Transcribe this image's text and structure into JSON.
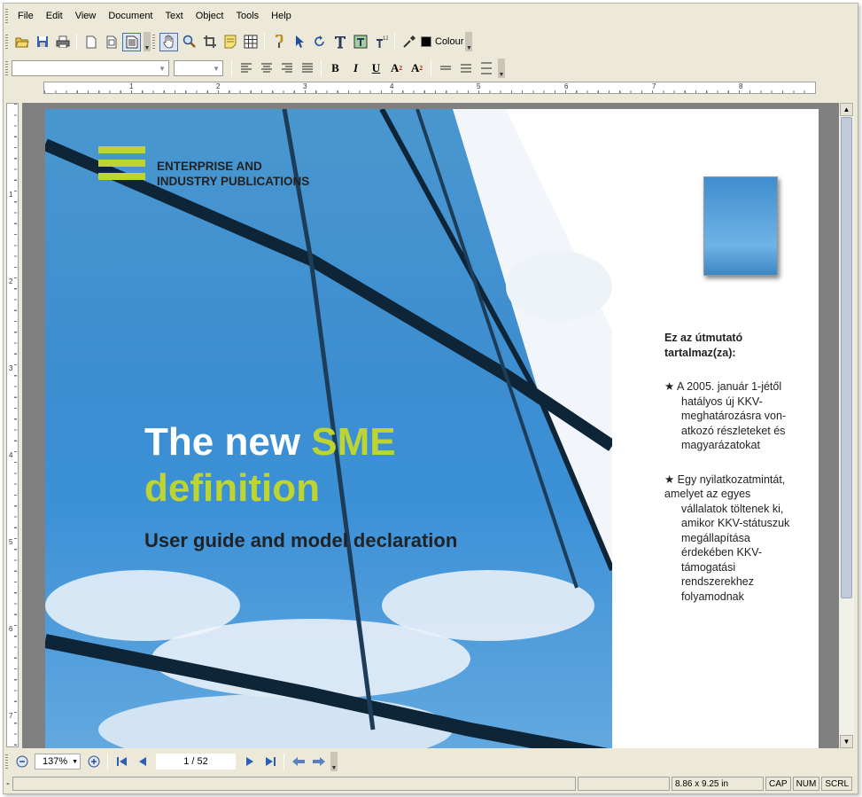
{
  "menu": [
    "File",
    "Edit",
    "View",
    "Document",
    "Text",
    "Object",
    "Tools",
    "Help"
  ],
  "toolbar": {
    "colour_label": "Colour"
  },
  "ruler": {
    "h_marks": [
      "1",
      "2",
      "3",
      "4",
      "5",
      "6",
      "7",
      "8"
    ],
    "v_marks": [
      "1",
      "2",
      "3",
      "4",
      "5",
      "6",
      "7"
    ]
  },
  "cover": {
    "logo_line1": "ENTERPRISE AND",
    "logo_line2": "INDUSTRY PUBLICATIONS",
    "title_white": "The new ",
    "title_green1": "SME",
    "title_green2": "definition",
    "subtitle": "User guide and model declaration",
    "accent": "#bed431"
  },
  "side": {
    "heading1": "Ez az útmutató",
    "heading2": "tartalmaz(za):",
    "bullets": [
      {
        "first": "★  A 2005. január 1-jétől",
        "rest": [
          "hatályos új KKV-",
          "meghatározásra von-",
          "atkozó részleteket és",
          "magyarázatokat"
        ]
      },
      {
        "first": "★  Egy nyilatkozatmintát,",
        "first2": "amelyet az egyes",
        "rest": [
          "vállalatok töltenek ki,",
          "amikor KKV-státuszuk",
          "megállapítása",
          "érdekében KKV-",
          "támogatási",
          "rendszerekhez",
          "folyamodnak"
        ]
      }
    ]
  },
  "nav": {
    "zoom": "137%",
    "page": "1 / 52"
  },
  "status": {
    "size": "8.86 x 9.25 in",
    "cap": "CAP",
    "num": "NUM",
    "scrl": "SCRL"
  }
}
